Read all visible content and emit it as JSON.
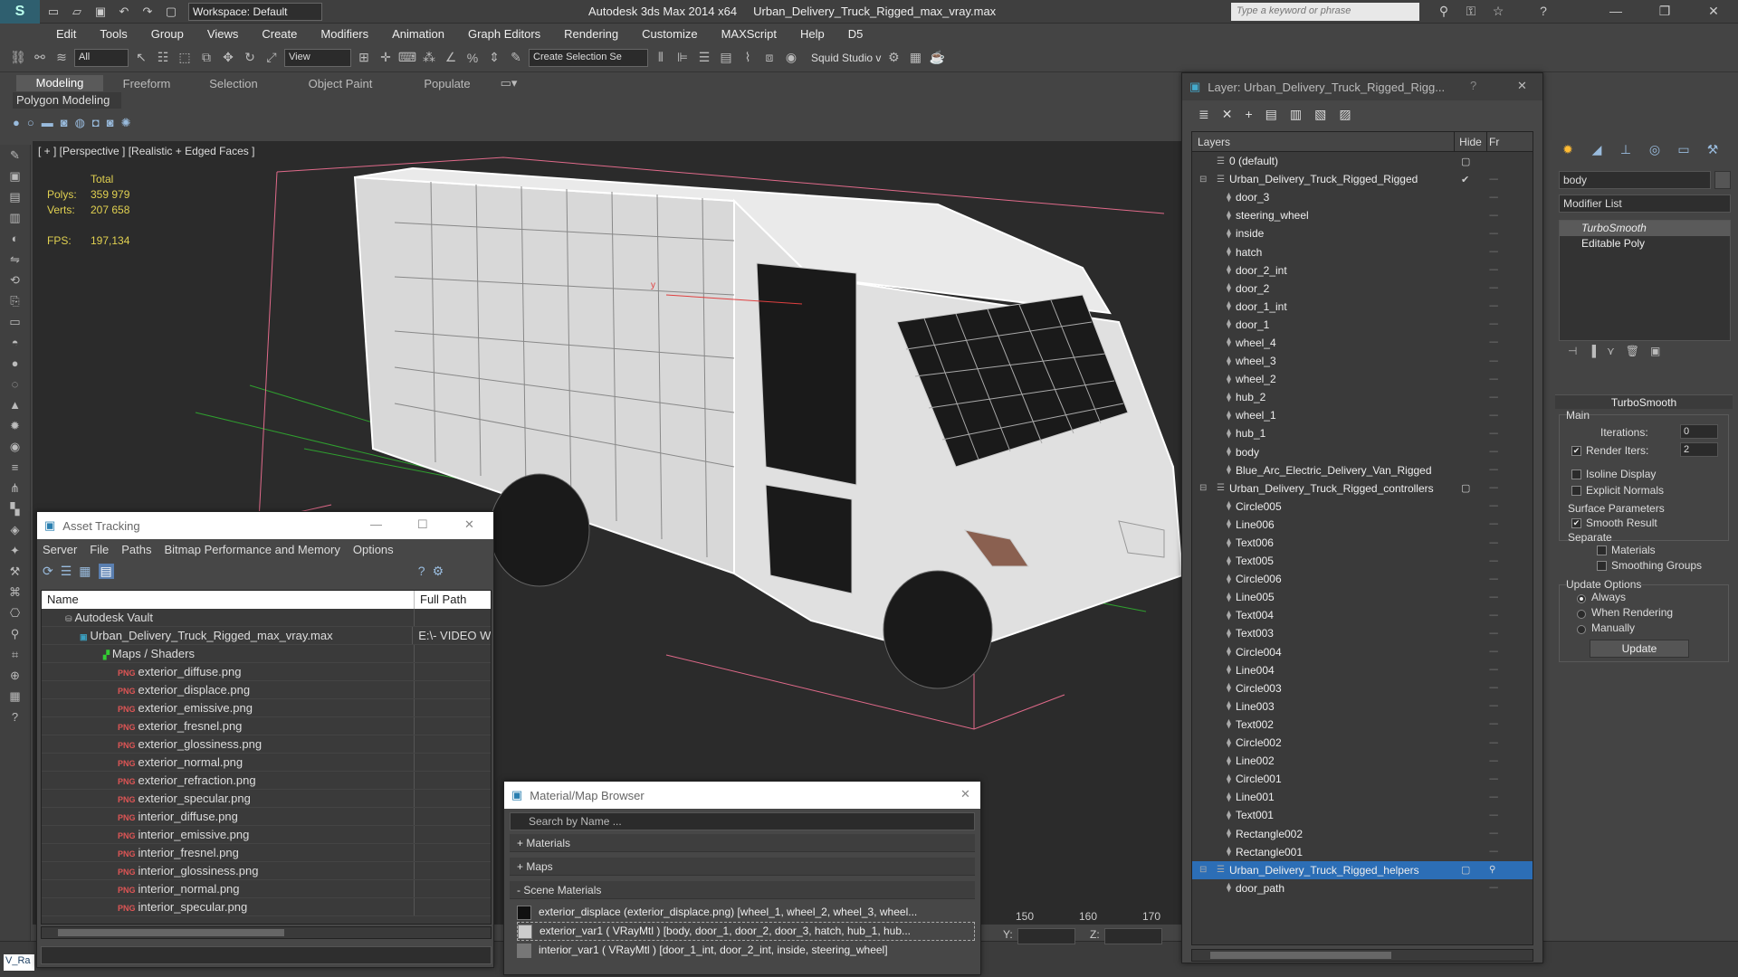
{
  "titlebar": {
    "workspace": "Workspace: Default",
    "app_title": "Autodesk 3ds Max  2014 x64",
    "file_title": "Urban_Delivery_Truck_Rigged_max_vray.max",
    "search_placeholder": "Type a keyword or phrase"
  },
  "menu": [
    "Edit",
    "Tools",
    "Group",
    "Views",
    "Create",
    "Modifiers",
    "Animation",
    "Graph Editors",
    "Rendering",
    "Customize",
    "MAXScript",
    "Help",
    "D5"
  ],
  "toolbar": {
    "filter": "All",
    "refcoord": "View",
    "selection_set": "Create Selection Se",
    "squid": "Squid Studio v"
  },
  "ribbon": {
    "tabs": [
      "Modeling",
      "Freeform",
      "Selection",
      "Object Paint",
      "Populate"
    ],
    "active_tab": "Modeling",
    "subpanel": "Polygon Modeling"
  },
  "viewport": {
    "label": "[ + ] [Perspective ] [Realistic + Edged Faces ]",
    "stats_total": "Total",
    "polys_label": "Polys:",
    "polys_value": "359 979",
    "verts_label": "Verts:",
    "verts_value": "207 658",
    "fps_label": "FPS:",
    "fps_value": "197,134"
  },
  "timeline": {
    "ticks": [
      "150",
      "160",
      "170"
    ],
    "y_label": "Y:",
    "z_label": "Z:"
  },
  "asset_tracking": {
    "title": "Asset Tracking",
    "menu": [
      "Server",
      "File",
      "Paths",
      "Bitmap Performance and Memory",
      "Options"
    ],
    "columns": [
      "Name",
      "Full Path"
    ],
    "vault": "Autodesk Vault",
    "max_file": "Urban_Delivery_Truck_Rigged_max_vray.max",
    "max_path": "E:\\- VIDEO W",
    "maps_folder": "Maps / Shaders",
    "files": [
      "exterior_diffuse.png",
      "exterior_displace.png",
      "exterior_emissive.png",
      "exterior_fresnel.png",
      "exterior_glossiness.png",
      "exterior_normal.png",
      "exterior_refraction.png",
      "exterior_specular.png",
      "interior_diffuse.png",
      "interior_emissive.png",
      "interior_fresnel.png",
      "interior_glossiness.png",
      "interior_normal.png",
      "interior_specular.png"
    ]
  },
  "material_browser": {
    "title": "Material/Map Browser",
    "search_placeholder": "Search by Name ...",
    "sections": [
      "+ Materials",
      "+ Maps",
      "- Scene Materials"
    ],
    "rows": [
      "exterior_displace (exterior_displace.png) [wheel_1, wheel_2, wheel_3, wheel...",
      "exterior_var1  ( VRayMtl ) [body, door_1, door_2, door_3, hatch, hub_1, hub...",
      "interior_var1  ( VRayMtl ) [door_1_int, door_2_int, inside, steering_wheel]"
    ]
  },
  "layers": {
    "title": "Layer: Urban_Delivery_Truck_Rigged_Rigg...",
    "col_layers": "Layers",
    "col_hide": "Hide",
    "col_freeze": "Fr",
    "rows": [
      {
        "name": "0 (default)",
        "level": 0,
        "kind": "layer"
      },
      {
        "name": "Urban_Delivery_Truck_Rigged_Rigged",
        "level": 0,
        "kind": "layer",
        "active": "✔"
      },
      {
        "name": "door_3",
        "level": 1,
        "kind": "obj"
      },
      {
        "name": "steering_wheel",
        "level": 1,
        "kind": "obj"
      },
      {
        "name": "inside",
        "level": 1,
        "kind": "obj"
      },
      {
        "name": "hatch",
        "level": 1,
        "kind": "obj"
      },
      {
        "name": "door_2_int",
        "level": 1,
        "kind": "obj"
      },
      {
        "name": "door_2",
        "level": 1,
        "kind": "obj"
      },
      {
        "name": "door_1_int",
        "level": 1,
        "kind": "obj"
      },
      {
        "name": "door_1",
        "level": 1,
        "kind": "obj"
      },
      {
        "name": "wheel_4",
        "level": 1,
        "kind": "obj"
      },
      {
        "name": "wheel_3",
        "level": 1,
        "kind": "obj"
      },
      {
        "name": "wheel_2",
        "level": 1,
        "kind": "obj"
      },
      {
        "name": "hub_2",
        "level": 1,
        "kind": "obj"
      },
      {
        "name": "wheel_1",
        "level": 1,
        "kind": "obj"
      },
      {
        "name": "hub_1",
        "level": 1,
        "kind": "obj"
      },
      {
        "name": "body",
        "level": 1,
        "kind": "obj"
      },
      {
        "name": "Blue_Arc_Electric_Delivery_Van_Rigged",
        "level": 1,
        "kind": "obj"
      },
      {
        "name": "Urban_Delivery_Truck_Rigged_controllers",
        "level": 0,
        "kind": "layer"
      },
      {
        "name": "Circle005",
        "level": 1,
        "kind": "obj"
      },
      {
        "name": "Line006",
        "level": 1,
        "kind": "obj"
      },
      {
        "name": "Text006",
        "level": 1,
        "kind": "obj"
      },
      {
        "name": "Text005",
        "level": 1,
        "kind": "obj"
      },
      {
        "name": "Circle006",
        "level": 1,
        "kind": "obj"
      },
      {
        "name": "Line005",
        "level": 1,
        "kind": "obj"
      },
      {
        "name": "Text004",
        "level": 1,
        "kind": "obj"
      },
      {
        "name": "Text003",
        "level": 1,
        "kind": "obj"
      },
      {
        "name": "Circle004",
        "level": 1,
        "kind": "obj"
      },
      {
        "name": "Line004",
        "level": 1,
        "kind": "obj"
      },
      {
        "name": "Circle003",
        "level": 1,
        "kind": "obj"
      },
      {
        "name": "Line003",
        "level": 1,
        "kind": "obj"
      },
      {
        "name": "Text002",
        "level": 1,
        "kind": "obj"
      },
      {
        "name": "Circle002",
        "level": 1,
        "kind": "obj"
      },
      {
        "name": "Line002",
        "level": 1,
        "kind": "obj"
      },
      {
        "name": "Circle001",
        "level": 1,
        "kind": "obj"
      },
      {
        "name": "Line001",
        "level": 1,
        "kind": "obj"
      },
      {
        "name": "Text001",
        "level": 1,
        "kind": "obj"
      },
      {
        "name": "Rectangle002",
        "level": 1,
        "kind": "obj"
      },
      {
        "name": "Rectangle001",
        "level": 1,
        "kind": "obj"
      },
      {
        "name": "Urban_Delivery_Truck_Rigged_helpers",
        "level": 0,
        "kind": "layer",
        "selected": true
      },
      {
        "name": "door_path",
        "level": 1,
        "kind": "obj"
      }
    ]
  },
  "command_panel": {
    "object_name": "body",
    "modifier_list": "Modifier List",
    "stack": [
      "TurboSmooth",
      "Editable Poly"
    ],
    "rollout": "TurboSmooth",
    "main_label": "Main",
    "iterations_label": "Iterations:",
    "iterations_value": "0",
    "render_iters_label": "Render Iters:",
    "render_iters_value": "2",
    "isoline": "Isoline Display",
    "explicit": "Explicit Normals",
    "surface_params": "Surface Parameters",
    "smooth_result": "Smooth Result",
    "separate": "Separate",
    "materials": "Materials",
    "smoothing_groups": "Smoothing Groups",
    "update_options": "Update Options",
    "always": "Always",
    "when_rendering": "When Rendering",
    "manually": "Manually",
    "update_button": "Update"
  },
  "status": {
    "left_tag": "V_Ra"
  },
  "colors": {
    "selection_blue": "#2c6eb6",
    "stats_yellow": "#e0d050",
    "grid_green": "#2fa02f",
    "bbox_pink": "#e06a8a"
  }
}
